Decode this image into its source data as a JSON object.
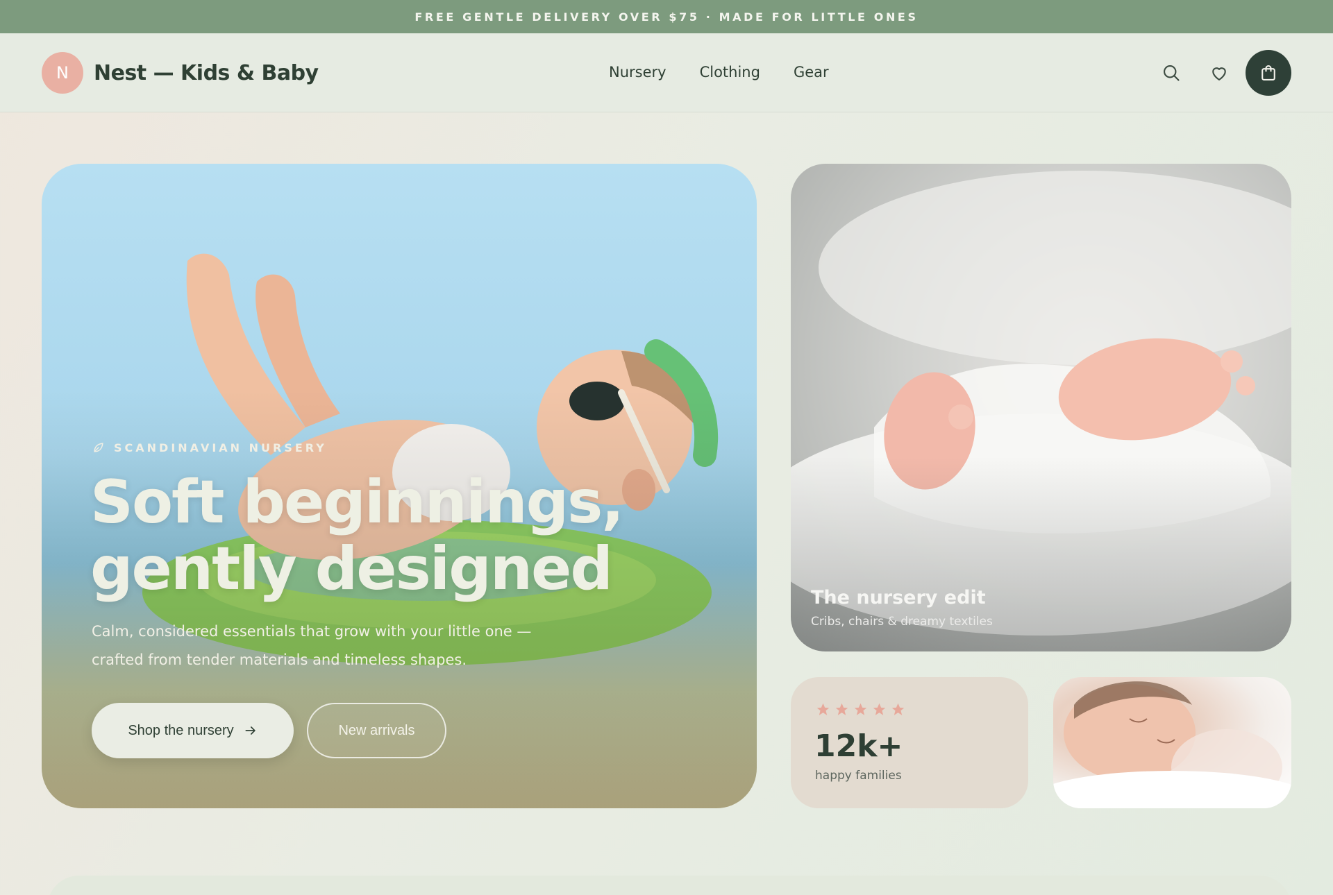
{
  "announcement": "FREE GENTLE DELIVERY OVER $75 · MADE FOR LITTLE ONES",
  "header": {
    "logo_initial": "N",
    "brand": "Nest — Kids & Baby",
    "nav": [
      "Nursery",
      "Clothing",
      "Gear"
    ]
  },
  "hero": {
    "eyebrow": "SCANDINAVIAN NURSERY",
    "title_line1": "Soft beginnings,",
    "title_line2": "gently designed",
    "subtitle_line1": "Calm, considered essentials that grow with your little one —",
    "subtitle_line2": "crafted from tender materials and timeless shapes.",
    "primary_cta": "Shop the nursery",
    "secondary_cta": "New arrivals"
  },
  "edit_card": {
    "title": "The nursery edit",
    "subtitle": "Cribs, chairs & dreamy textiles"
  },
  "stat_card": {
    "rating_stars": 5,
    "number": "12k+",
    "label": "happy families"
  },
  "colors": {
    "announcement_bg": "#7d9b7e",
    "brand_dark": "#2e4037",
    "logo_badge": "#e9b0a3",
    "star": "#e7a89a"
  },
  "icons": [
    "leaf-icon",
    "search-icon",
    "heart-icon",
    "shopping-bag-icon",
    "arrow-right-icon",
    "star-icon"
  ]
}
